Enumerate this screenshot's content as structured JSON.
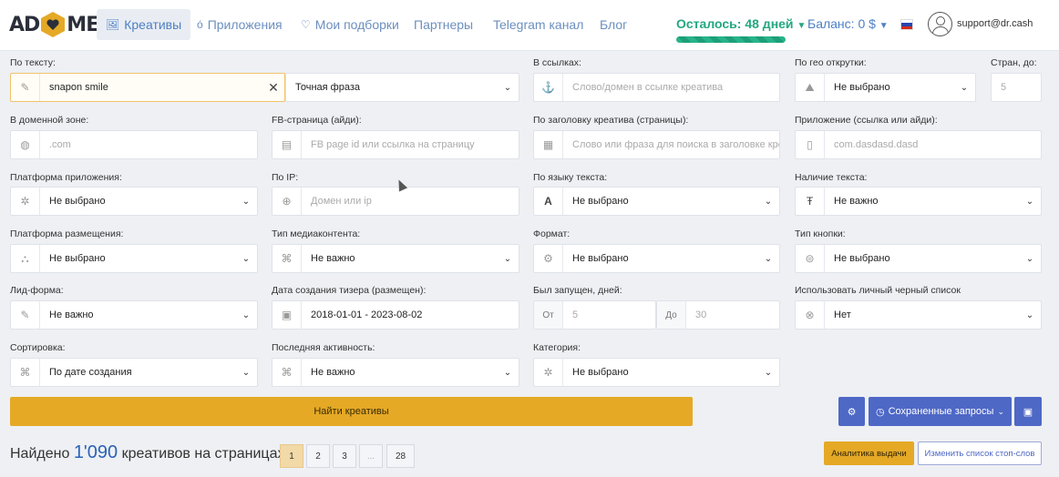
{
  "logo": {
    "left": "AD",
    "right": "ME"
  },
  "nav": {
    "creatives": "Креативы",
    "apps": "Приложения",
    "collections": "Мои подборки",
    "partners": "Партнеры",
    "telegram": "Telegram канал",
    "blog": "Блог"
  },
  "status": {
    "remaining": "Осталось: 48 дней",
    "balance": "Баланс: 0 $",
    "email": "support@dr.cash"
  },
  "colors": {
    "accent": "#e5a926",
    "link": "#4d7fc4",
    "primary": "#4e68c6",
    "success": "#22a77f"
  },
  "filters": {
    "by_text": {
      "label": "По тексту:",
      "value": "snapon smile",
      "mode": "Точная фраза"
    },
    "in_links": {
      "label": "В ссылках:",
      "placeholder": "Слово/домен в ссылке креатива"
    },
    "geo": {
      "label": "По гео открутки:",
      "value": "Не выбрано"
    },
    "countries_to": {
      "label": "Стран, до:",
      "placeholder": "5"
    },
    "domain_zone": {
      "label": "В доменной зоне:",
      "placeholder": ".com"
    },
    "fb_page": {
      "label": "FB-страница (айди):",
      "placeholder": "FB page id или ссылка на страницу"
    },
    "title": {
      "label": "По заголовку креатива (страницы):",
      "placeholder": "Слово или фраза для поиска в заголовке креа"
    },
    "app": {
      "label": "Приложение (ссылка или айди):",
      "placeholder": "com.dasdasd.dasd"
    },
    "app_platform": {
      "label": "Платформа приложения:",
      "value": "Не выбрано"
    },
    "ip": {
      "label": "По IP:",
      "placeholder": "Домен или  ip"
    },
    "language": {
      "label": "По языку текста:",
      "value": "Не выбрано"
    },
    "has_text": {
      "label": "Наличие текста:",
      "value": "Не важно"
    },
    "placement": {
      "label": "Платформа размещения:",
      "value": "Не выбрано"
    },
    "media_type": {
      "label": "Тип медиаконтента:",
      "value": "Не важно"
    },
    "format": {
      "label": "Формат:",
      "value": "Не выбрано"
    },
    "button_type": {
      "label": "Тип кнопки:",
      "value": "Не выбрано"
    },
    "lead_form": {
      "label": "Лид-форма:",
      "value": "Не важно"
    },
    "created": {
      "label": "Дата создания тизера (размещен):",
      "value": "2018-01-01 - 2023-08-02"
    },
    "launched_days": {
      "label": "Был запущен, дней:",
      "from_label": "От",
      "from_ph": "5",
      "to_label": "До",
      "to_ph": "30"
    },
    "blacklist": {
      "label": "Использовать личный черный список",
      "value": "Нет"
    },
    "sorting": {
      "label": "Сортировка:",
      "value": "По дате создания"
    },
    "last_activity": {
      "label": "Последняя активность:",
      "value": "Не важно"
    },
    "category": {
      "label": "Категория:",
      "value": "Не выбрано"
    }
  },
  "actions": {
    "find": "Найти креативы",
    "saved": "Сохраненные запросы",
    "analytics": "Аналитика выдачи",
    "stoplist": "Изменить список стоп-слов"
  },
  "results": {
    "prefix": "Найдено",
    "count": "1'090",
    "suffix": "креативов на страницах:",
    "pages": [
      "1",
      "2",
      "3",
      "...",
      "28"
    ]
  }
}
